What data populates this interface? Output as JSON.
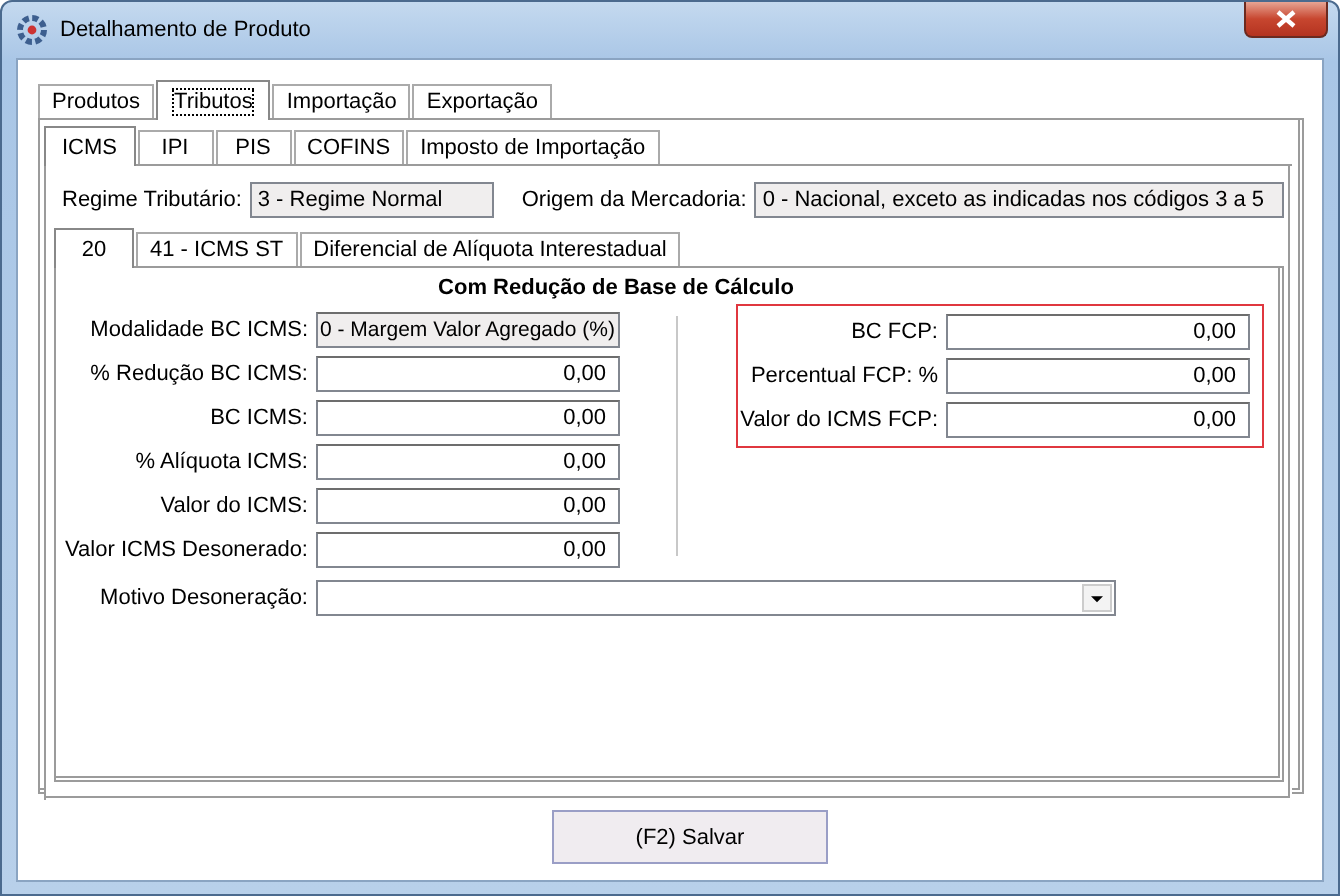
{
  "window": {
    "title": "Detalhamento de Produto"
  },
  "main_tabs": [
    {
      "label": "Produtos",
      "selected": false
    },
    {
      "label": "Tributos",
      "selected": true
    },
    {
      "label": "Importação",
      "selected": false
    },
    {
      "label": "Exportação",
      "selected": false
    }
  ],
  "tax_tabs": [
    {
      "label": "ICMS",
      "selected": true
    },
    {
      "label": "IPI",
      "selected": false
    },
    {
      "label": "PIS",
      "selected": false
    },
    {
      "label": "COFINS",
      "selected": false
    },
    {
      "label": "Imposto de Importação",
      "selected": false
    }
  ],
  "regime": {
    "label": "Regime Tributário:",
    "value": "3 - Regime Normal"
  },
  "origem": {
    "label": "Origem da Mercadoria:",
    "value": "0 - Nacional, exceto as indicadas nos códigos 3 a 5"
  },
  "cst_tabs": [
    {
      "label": "20",
      "selected": true
    },
    {
      "label": "41 - ICMS ST",
      "selected": false
    },
    {
      "label": "Diferencial de Alíquota Interestadual",
      "selected": false
    }
  ],
  "section_title": "Com Redução de Base de Cálculo",
  "left_fields": [
    {
      "label": "Modalidade BC ICMS:",
      "value": "0 - Margem Valor Agregado (%)",
      "kind": "readonly"
    },
    {
      "label": "% Redução BC ICMS:",
      "value": "0,00",
      "kind": "number"
    },
    {
      "label": "BC ICMS:",
      "value": "0,00",
      "kind": "number"
    },
    {
      "label": "% Alíquota ICMS:",
      "value": "0,00",
      "kind": "number"
    },
    {
      "label": "Valor do ICMS:",
      "value": "0,00",
      "kind": "number"
    },
    {
      "label": "Valor ICMS Desonerado:",
      "value": "0,00",
      "kind": "number"
    }
  ],
  "fcp_fields": [
    {
      "label": "BC FCP:",
      "value": "0,00",
      "kind": "number"
    },
    {
      "label": "Percentual FCP: %",
      "value": "0,00",
      "kind": "number"
    },
    {
      "label": "Valor do ICMS FCP:",
      "value": "0,00",
      "kind": "number"
    }
  ],
  "motivo": {
    "label": "Motivo Desoneração:"
  },
  "save_button": "(F2) Salvar"
}
